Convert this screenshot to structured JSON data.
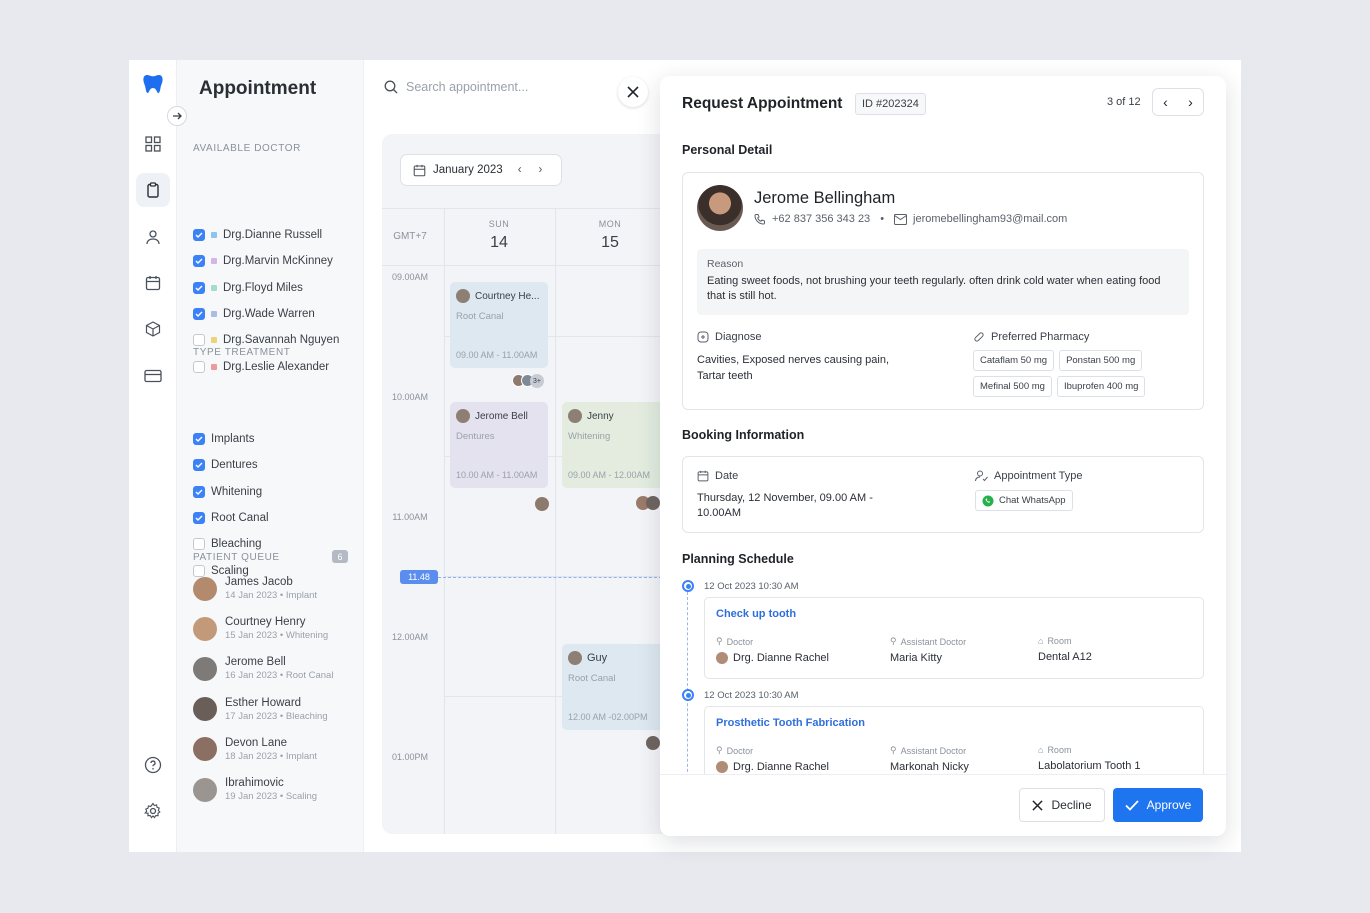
{
  "app": {
    "title": "Appointment",
    "search_placeholder": "Search appointment..."
  },
  "sidebar": {
    "doctor_heading": "AVAILABLE DOCTOR",
    "doctors": [
      {
        "name": "Drg.Dianne Russell",
        "checked": true,
        "color": "#8fc4ea"
      },
      {
        "name": "Drg.Marvin McKinney",
        "checked": true,
        "color": "#d4b5e8"
      },
      {
        "name": "Drg.Floyd Miles",
        "checked": true,
        "color": "#a9dcc8"
      },
      {
        "name": "Drg.Wade Warren",
        "checked": true,
        "color": "#a9bde6"
      },
      {
        "name": "Drg.Savannah Nguyen",
        "checked": false,
        "color": "#ead67a"
      },
      {
        "name": "Drg.Leslie Alexander",
        "checked": false,
        "color": "#ec9a9a"
      }
    ],
    "treatment_heading": "TYPE TREATMENT",
    "treatments": [
      {
        "name": "Implants",
        "checked": true
      },
      {
        "name": "Dentures",
        "checked": true
      },
      {
        "name": "Whitening",
        "checked": true
      },
      {
        "name": "Root Canal",
        "checked": true
      },
      {
        "name": "Bleaching",
        "checked": false
      },
      {
        "name": "Scaling",
        "checked": false
      }
    ],
    "queue_heading": "PATIENT QUEUE",
    "queue_count": "6",
    "queue": [
      {
        "name": "James Jacob",
        "sub": "14 Jan 2023 • Implant"
      },
      {
        "name": "Courtney Henry",
        "sub": "15 Jan 2023 • Whitening"
      },
      {
        "name": "Jerome Bell",
        "sub": "16 Jan 2023 • Root Canal"
      },
      {
        "name": "Esther Howard",
        "sub": "17 Jan 2023 • Bleaching"
      },
      {
        "name": "Devon Lane",
        "sub": "18 Jan 2023 • Implant"
      },
      {
        "name": "Ibrahimovic",
        "sub": "19 Jan 2023 • Scaling"
      }
    ]
  },
  "calendar": {
    "month": "January 2023",
    "timezone": "GMT+7",
    "days": [
      {
        "dow": "SUN",
        "num": "14"
      },
      {
        "dow": "MON",
        "num": "15"
      }
    ],
    "times": [
      "09.00AM",
      "10.00AM",
      "11.00AM",
      "12.00AM",
      "01.00PM"
    ],
    "now": "11.48",
    "events": [
      {
        "name": "Courtney He...",
        "type": "Root Canal",
        "time": "09.00 AM - 11.00AM",
        "more": "3+"
      },
      {
        "name": "Jerome Bell",
        "type": "Dentures",
        "time": "10.00 AM - 11.00AM"
      },
      {
        "name": "Jenny",
        "type": "Whitening",
        "time": "09.00 AM - 12.00AM"
      },
      {
        "name": "Guy",
        "type": "Root Canal",
        "time": "12.00 AM -02.00PM"
      }
    ]
  },
  "request": {
    "title": "Request Appointment",
    "id": "ID #202324",
    "pager": "3 of 12",
    "personal_heading": "Personal Detail",
    "patient": {
      "name": "Jerome Bellingham",
      "phone": "+62 837 356 343 23",
      "sep": "•",
      "email": "jeromebellingham93@mail.com"
    },
    "reason_label": "Reason",
    "reason": "Eating sweet foods, not brushing your teeth regularly. often drink cold water when eating food that is still hot.",
    "diagnose_label": "Diagnose",
    "diagnose": "Cavities, Exposed nerves causing pain, Tartar teeth",
    "pharmacy_label": "Preferred Pharmacy",
    "pharmacy": [
      "Cataflam 50 mg",
      "Ponstan 500 mg",
      "Mefinal 500 mg",
      "Ibuprofen 400 mg"
    ],
    "booking_heading": "Booking Information",
    "date_label": "Date",
    "date": "Thursday, 12 November, 09.00 AM - 10.00AM",
    "type_label": "Appointment Type",
    "type": "Chat WhatsApp",
    "planning_heading": "Planning Schedule",
    "plans": [
      {
        "date": "12 Oct 2023  10:30 AM",
        "title": "Check up tooth",
        "doctor_label": "Doctor",
        "doctor": "Drg. Dianne Rachel",
        "assistant_label": "Assistant Doctor",
        "assistant": "Maria Kitty",
        "room_label": "Room",
        "room": "Dental A12"
      },
      {
        "date": "12 Oct 2023  10:30 AM",
        "title": "Prosthetic Tooth Fabrication",
        "doctor_label": "Doctor",
        "doctor": "Drg. Dianne Rachel",
        "assistant_label": "Assistant Doctor",
        "assistant": "Markonah Nicky",
        "room_label": "Room",
        "room": "Labolatorium Tooth 1"
      }
    ],
    "decline": "Decline",
    "approve": "Approve"
  }
}
